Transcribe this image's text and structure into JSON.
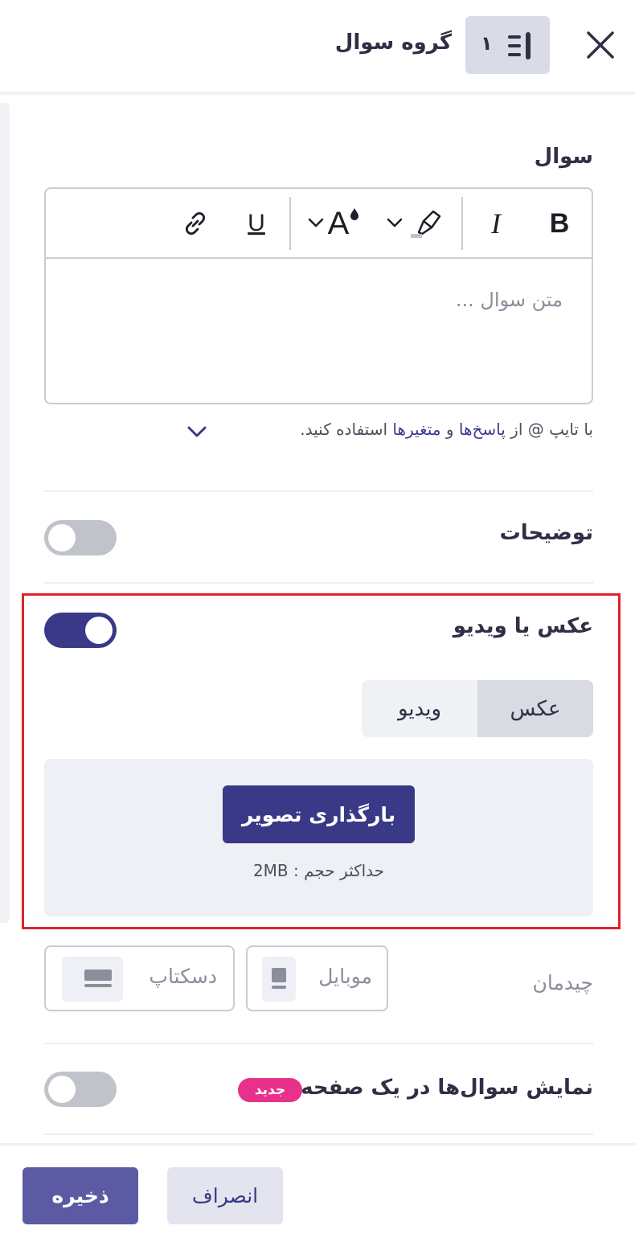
{
  "header": {
    "title": "گروه سوال",
    "group_number": "۱"
  },
  "question": {
    "label": "سوال",
    "placeholder": "متن سوال ...",
    "hint_prefix": "با تایپ @ از ",
    "hint_link_1": "پاسخ‌ها",
    "hint_and": " و ",
    "hint_link_2": "متغیرها",
    "hint_suffix": " استفاده کنید.",
    "toolbar": {
      "bold": "B",
      "italic": "I",
      "font_size": "A",
      "underline": "U"
    }
  },
  "description": {
    "label": "توضیحات",
    "enabled": false
  },
  "media": {
    "label": "عکس یا ویدیو",
    "enabled": true,
    "tabs": [
      {
        "label": "عکس",
        "active": true
      },
      {
        "label": "ویدیو",
        "active": false
      }
    ],
    "upload_button": "بارگذاری تصویر",
    "max_size_note": "حداکثر حجم : 2MB"
  },
  "layout": {
    "label": "چیدمان",
    "options": [
      {
        "label": "موبایل"
      },
      {
        "label": "دسکتاپ"
      }
    ]
  },
  "one_page": {
    "label": "نمایش سوال‌ها در یک صفحه",
    "badge": "جدید",
    "enabled": false
  },
  "footer": {
    "save": "ذخیره",
    "cancel": "انصراف"
  },
  "colors": {
    "primary": "#393987",
    "highlight": "#e0222b",
    "new_badge": "#e8318a"
  }
}
